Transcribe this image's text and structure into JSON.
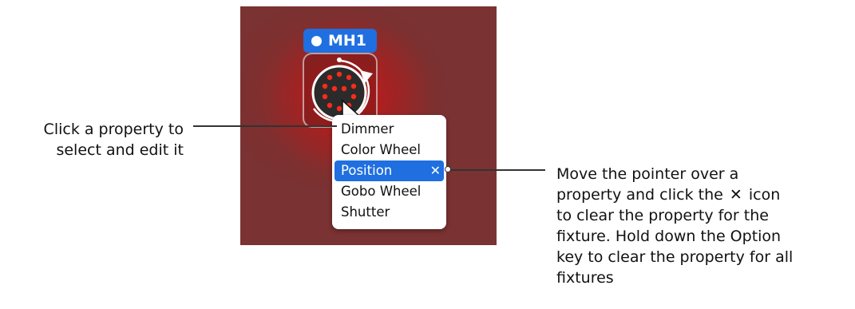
{
  "fixture": {
    "name": "MH1",
    "icon": "moving-head-icon",
    "indicator_color": "#ffffff",
    "badge_color": "#1f6fe0",
    "lamp_color": "#ff2a1a"
  },
  "menu": {
    "items": [
      {
        "label": "Dimmer",
        "selected": false
      },
      {
        "label": "Color Wheel",
        "selected": false
      },
      {
        "label": "Position",
        "selected": true,
        "clear_glyph": "✕"
      },
      {
        "label": "Gobo Wheel",
        "selected": false
      },
      {
        "label": "Shutter",
        "selected": false
      }
    ],
    "selection_color": "#1f6fe0"
  },
  "callouts": {
    "left": {
      "line1": "Click a property to",
      "line2": "select and edit it"
    },
    "right": {
      "line1": "Move the pointer over a",
      "line2_before": "property and click the",
      "line2_glyph": "✕",
      "line2_after": "icon",
      "line3": "to clear the property for the",
      "line4": "fixture. Hold down the Option",
      "line5": "key to clear the property for all",
      "line6": "fixtures"
    }
  },
  "canvas": {
    "background": "#7a3232",
    "glow": "#c81e1e"
  }
}
